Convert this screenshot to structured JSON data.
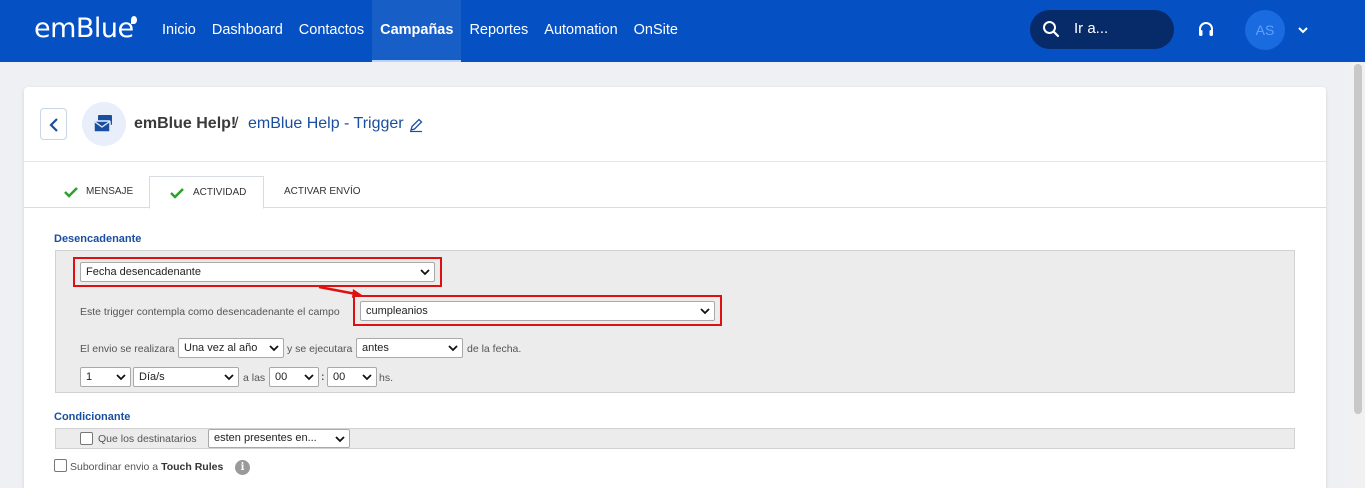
{
  "brand": {
    "logo": "emBlue"
  },
  "nav": {
    "items": [
      {
        "label": "Inicio"
      },
      {
        "label": "Dashboard"
      },
      {
        "label": "Contactos"
      },
      {
        "label": "Campañas"
      },
      {
        "label": "Reportes"
      },
      {
        "label": "Automation"
      },
      {
        "label": "OnSite"
      }
    ],
    "active": "Campañas"
  },
  "search": {
    "placeholder": "Ir a..."
  },
  "user": {
    "initials": "AS"
  },
  "header": {
    "campaign": "emBlue Help!",
    "separator": "/",
    "trigger_name": "emBlue Help - Trigger"
  },
  "tabs": [
    {
      "label": "MENSAJE",
      "done": true
    },
    {
      "label": "ACTIVIDAD",
      "done": true,
      "active": true
    },
    {
      "label": "ACTIVAR ENVÍO",
      "done": false
    }
  ],
  "trigger": {
    "section_label": "Desencadenante",
    "type_select": "Fecha desencadenante",
    "field_label": "Este trigger contempla como desencadenante el campo",
    "field_select": "cumpleanios",
    "send_label": "El envio se realizara",
    "frequency_select": "Una vez al año",
    "exec_label": "y se ejecutara",
    "when_select": "antes",
    "date_label": "de la fecha.",
    "amount_select": "1",
    "unit_select": "Día/s",
    "at_label": "a las",
    "hour_select": "00",
    "colon": ":",
    "minute_select": "00",
    "hs_label": "hs."
  },
  "condition": {
    "section_label": "Condicionante",
    "checkbox_label": "Que los destinatarios",
    "select_value": "esten presentes en...",
    "subordinate_prefix": "Subordinar envio a",
    "subordinate_bold": "Touch Rules"
  },
  "colors": {
    "nav_bg": "#0551c3",
    "accent_blue": "#1a4fa0",
    "check_green": "#2ca02c",
    "highlight_red": "#e01010"
  }
}
